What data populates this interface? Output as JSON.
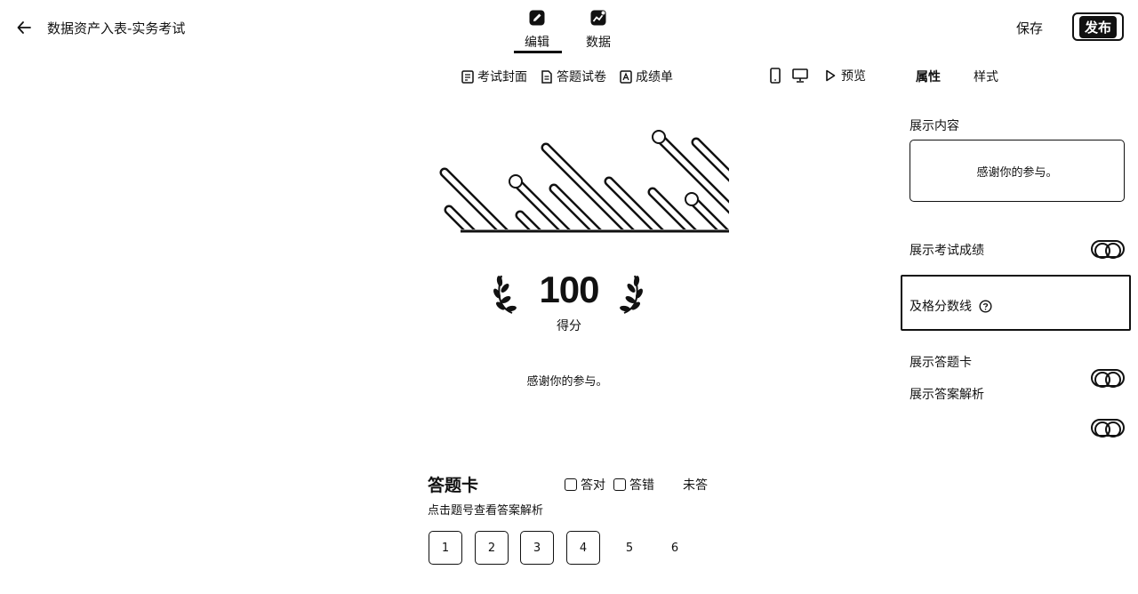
{
  "header": {
    "back_icon": "arrow-left-icon",
    "title": "数据资产入表-实务考试",
    "tabs": [
      {
        "label": "编辑",
        "icon": "edit-icon",
        "active": true
      },
      {
        "label": "数据",
        "icon": "chart-icon",
        "active": false
      }
    ],
    "save_label": "保存",
    "publish_label": "发布"
  },
  "toolbar": {
    "sub_tabs": [
      {
        "label": "考试封面",
        "icon": "cover-icon"
      },
      {
        "label": "答题试卷",
        "icon": "paper-icon"
      },
      {
        "label": "成绩单",
        "icon": "report-icon"
      }
    ],
    "device_icons": [
      "mobile-icon",
      "desktop-icon"
    ],
    "preview_label": "预览",
    "panel_tabs": [
      {
        "label": "属性",
        "active": true
      },
      {
        "label": "样式",
        "active": false
      }
    ]
  },
  "result": {
    "score": "100",
    "score_label": "得分",
    "thanks": "感谢你的参与。"
  },
  "answer_card": {
    "title": "答题卡",
    "legend": {
      "correct": "答对",
      "wrong": "答错",
      "unanswered": "未答"
    },
    "hint": "点击题号查看答案解析",
    "questions": [
      {
        "num": "1",
        "status": "answered"
      },
      {
        "num": "2",
        "status": "answered"
      },
      {
        "num": "3",
        "status": "answered"
      },
      {
        "num": "4",
        "status": "answered"
      },
      {
        "num": "5",
        "status": "unanswered"
      },
      {
        "num": "6",
        "status": "unanswered"
      }
    ]
  },
  "panel": {
    "content_label": "展示内容",
    "content_value": "感谢你的参与。",
    "show_score_label": "展示考试成绩",
    "show_score_on": true,
    "pass_line_label": "及格分数线",
    "pass_line_help_icon": "help-circle-icon",
    "show_card_label": "展示答题卡",
    "show_card_on": true,
    "show_analysis_label": "展示答案解析",
    "show_analysis_on": true
  },
  "colors": {
    "ink": "#111111",
    "background": "#ffffff"
  }
}
